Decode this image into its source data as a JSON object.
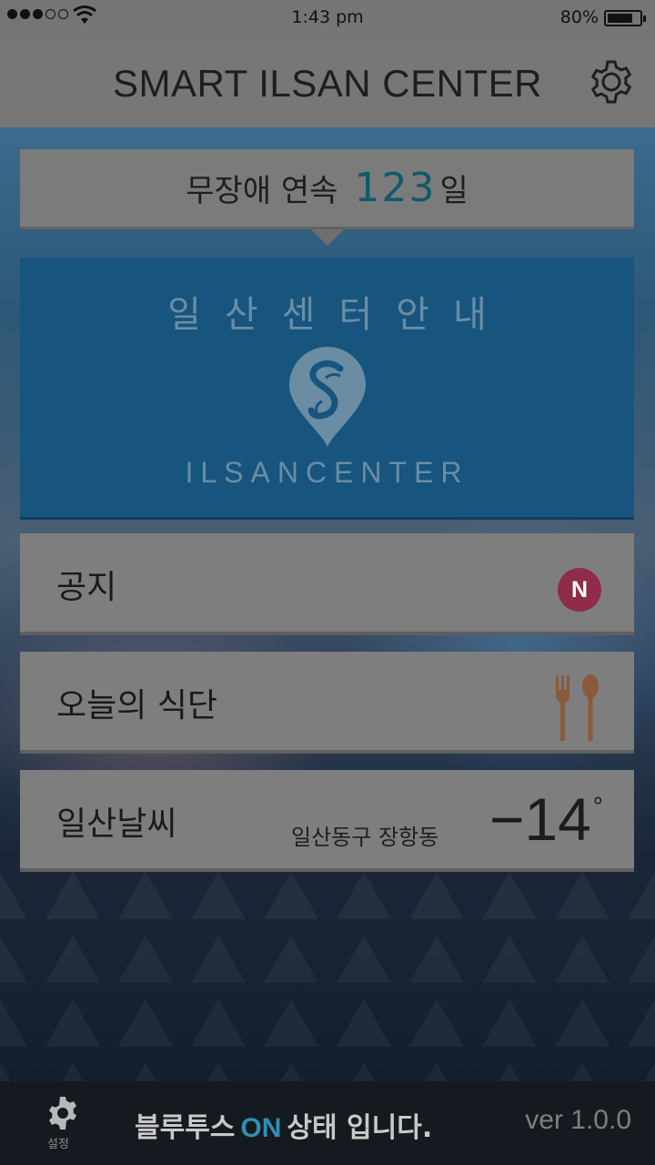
{
  "status_bar": {
    "time": "1:43 pm",
    "battery_percent": "80%",
    "battery_level": 0.8,
    "signal_bars_filled": 3,
    "signal_bars_total": 5
  },
  "header": {
    "title": "SMART ILSAN CENTER",
    "settings_icon": "gear-icon"
  },
  "streak": {
    "prefix": "무장애 연속",
    "count": "123",
    "unit": "일"
  },
  "center_guide": {
    "title": "일산센터안내",
    "logo_text": "ILSANCENTER",
    "logo_icon": "map-pin-s-logo"
  },
  "menu": {
    "notice_label": "공지",
    "notice_badge": "N",
    "meal_label": "오늘의 식단",
    "meal_icon": "fork-spoon-icon",
    "weather_label": "일산날씨",
    "weather_location": "일산동구 장항동",
    "weather_temp": "−14",
    "weather_degree": "°"
  },
  "footer": {
    "settings_label": "설정",
    "bt_prefix": "블루투스",
    "bt_state": "ON",
    "bt_suffix": "상태 입니다.",
    "version": "ver 1.0.0"
  },
  "colors": {
    "accent": "#2e8fb3",
    "guide_bg": "#17557f",
    "badge": "#8f2c4a",
    "cutlery": "#8a5a3a"
  }
}
